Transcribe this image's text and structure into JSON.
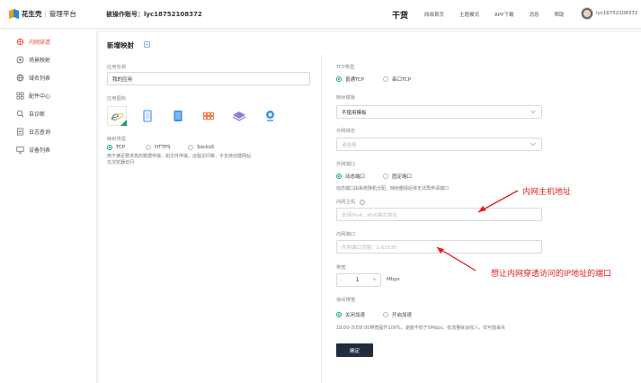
{
  "header": {
    "brand": "花生壳",
    "platform": "管理平台",
    "account_label": "被操作账号：lyc18752108372",
    "nav": [
      "干货",
      "网络首页",
      "主题模式",
      "APP下载",
      "消息",
      "帮助"
    ],
    "user_name": "lyc18752108372"
  },
  "sidebar": {
    "items": [
      {
        "label": "内网穿透",
        "icon": "penetration-icon",
        "active": true
      },
      {
        "label": "场景映射",
        "icon": "scene-icon",
        "active": false
      },
      {
        "label": "域名列表",
        "icon": "globe-icon",
        "active": false
      },
      {
        "label": "配件中心",
        "icon": "grid-icon",
        "active": false
      },
      {
        "label": "自诊断",
        "icon": "search-icon",
        "active": false
      },
      {
        "label": "日志查询",
        "icon": "document-icon",
        "active": false
      },
      {
        "label": "设备列表",
        "icon": "monitor-icon",
        "active": false
      }
    ]
  },
  "page": {
    "title": "新增映射"
  },
  "left_form": {
    "app_name_label": "应用名称",
    "app_name_value": "我的应用",
    "app_icon_label": "应用图标",
    "app_icons": [
      "ie-icon",
      "phone-icon",
      "tablet-icon",
      "film-icon",
      "layers-icon",
      "camera-icon"
    ],
    "app_type_label": "映射类型",
    "app_types": [
      "TCP",
      "HTTPS",
      "Socks5"
    ],
    "app_type_help": "用于满足要求高的数据传输，如文件传输，远程访问等，不支持创建网站在浏览器访问"
  },
  "right_form": {
    "tcp_type_label": "TCP类型",
    "tcp_types": [
      "普通TCP",
      "串口TCP"
    ],
    "template_label": "映射模板",
    "template_value": "不使用模板",
    "domain_label": "外网域名",
    "domain_placeholder": "请选择",
    "port_label": "外网端口",
    "port_options": [
      "动态端口",
      "固定端口"
    ],
    "port_help": "动态端口由系统随机分配，映射删除后将无法再申请端口",
    "host_label": "内网主机",
    "host_placeholder": "支持IPv4、IPv6格式地址",
    "inner_port_label": "内网端口",
    "inner_port_placeholder": "内网端口范围：1-65535",
    "bandwidth_label": "带宽",
    "bandwidth_minus": "-",
    "bandwidth_value": "1",
    "bandwidth_plus": "+",
    "bandwidth_unit": "Mbps",
    "accel_label": "夜间带宽",
    "accel_options": [
      "关闭加速",
      "开启加速"
    ],
    "accel_help": "18:00-次日8:00带宽提升100%，速度不低于5Mbps，有流量就会收入，仅可能丢失",
    "submit_label": "确定"
  },
  "annotations": {
    "host_note": "内网主机地址",
    "port_note": "想让内网穿透访问的IP地址的端口"
  },
  "colors": {
    "accent": "#e74c3c",
    "green": "#1aa260",
    "annotation": "#e02020",
    "button": "#1f2d3d"
  }
}
